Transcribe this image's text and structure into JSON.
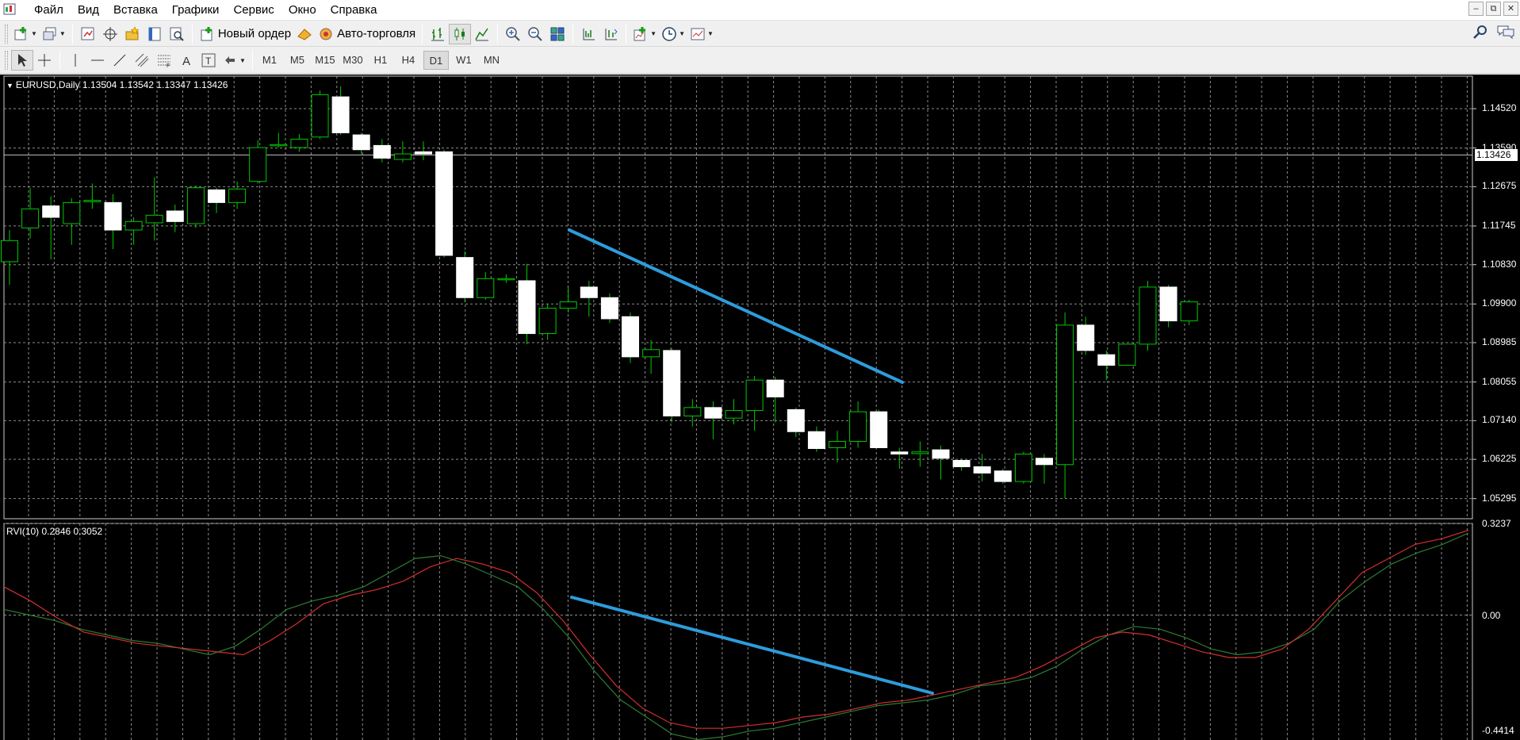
{
  "menu": {
    "items": [
      "Файл",
      "Вид",
      "Вставка",
      "Графики",
      "Сервис",
      "Окно",
      "Справка"
    ],
    "window_controls": [
      "–",
      "⧉",
      "✕"
    ]
  },
  "toolbar1": {
    "new_order_label": "Новый ордер",
    "auto_trading_label": "Авто-торговля"
  },
  "toolbar2": {
    "timeframes": [
      "M1",
      "M5",
      "M15",
      "M30",
      "H1",
      "H4",
      "D1",
      "W1",
      "MN"
    ],
    "active_timeframe": "D1"
  },
  "chart": {
    "main_title": "EURUSD,Daily  1.13504 1.13542 1.13347 1.13426",
    "indicator_title": "RVI(10) 0.2846 0.3052",
    "current_price": "1.13426",
    "price_labels": [
      "1.14520",
      "1.13590",
      "1.12675",
      "1.11745",
      "1.10830",
      "1.09900",
      "1.08985",
      "1.08055",
      "1.07140",
      "1.06225",
      "1.05295"
    ],
    "rvi_labels": [
      "0.3237",
      "0.00",
      "-0.4414"
    ],
    "colors": {
      "background": "#000000",
      "grid": "#8c8c8c",
      "bull_body": "#000000",
      "bear_body": "#ffffff",
      "wick": "#00c800",
      "rvi_main": "#2e7d32",
      "rvi_signal": "#d32f2f",
      "trendline": "#2d9cdb"
    }
  },
  "chart_data": {
    "type": "candlestick",
    "symbol": "EURUSD",
    "timeframe": "Daily",
    "ylim": [
      1.0482,
      1.1529
    ],
    "candles": [
      {
        "o": 1.109,
        "h": 1.1165,
        "l": 1.1035,
        "c": 1.114
      },
      {
        "o": 1.117,
        "h": 1.1265,
        "l": 1.1145,
        "c": 1.1215
      },
      {
        "o": 1.1222,
        "h": 1.1245,
        "l": 1.1095,
        "c": 1.1195
      },
      {
        "o": 1.118,
        "h": 1.124,
        "l": 1.113,
        "c": 1.123
      },
      {
        "o": 1.1232,
        "h": 1.1275,
        "l": 1.1215,
        "c": 1.1235
      },
      {
        "o": 1.123,
        "h": 1.125,
        "l": 1.112,
        "c": 1.1165
      },
      {
        "o": 1.1165,
        "h": 1.1195,
        "l": 1.113,
        "c": 1.1185
      },
      {
        "o": 1.1182,
        "h": 1.129,
        "l": 1.114,
        "c": 1.12
      },
      {
        "o": 1.121,
        "h": 1.1225,
        "l": 1.116,
        "c": 1.1185
      },
      {
        "o": 1.118,
        "h": 1.127,
        "l": 1.117,
        "c": 1.1265
      },
      {
        "o": 1.126,
        "h": 1.1265,
        "l": 1.1205,
        "c": 1.123
      },
      {
        "o": 1.123,
        "h": 1.128,
        "l": 1.1215,
        "c": 1.1262
      },
      {
        "o": 1.128,
        "h": 1.1378,
        "l": 1.1275,
        "c": 1.136
      },
      {
        "o": 1.1365,
        "h": 1.1395,
        "l": 1.136,
        "c": 1.1367
      },
      {
        "o": 1.136,
        "h": 1.1392,
        "l": 1.135,
        "c": 1.138
      },
      {
        "o": 1.1385,
        "h": 1.1495,
        "l": 1.138,
        "c": 1.1485
      },
      {
        "o": 1.148,
        "h": 1.1505,
        "l": 1.139,
        "c": 1.1395
      },
      {
        "o": 1.139,
        "h": 1.1395,
        "l": 1.1345,
        "c": 1.1355
      },
      {
        "o": 1.1365,
        "h": 1.138,
        "l": 1.1325,
        "c": 1.1335
      },
      {
        "o": 1.1332,
        "h": 1.1375,
        "l": 1.1325,
        "c": 1.1345
      },
      {
        "o": 1.135,
        "h": 1.1375,
        "l": 1.133,
        "c": 1.1345
      },
      {
        "o": 1.135,
        "h": 1.1355,
        "l": 1.11,
        "c": 1.1105
      },
      {
        "o": 1.11,
        "h": 1.1115,
        "l": 1.0995,
        "c": 1.1005
      },
      {
        "o": 1.1005,
        "h": 1.1065,
        "l": 1.1,
        "c": 1.105
      },
      {
        "o": 1.105,
        "h": 1.106,
        "l": 1.104,
        "c": 1.105
      },
      {
        "o": 1.1045,
        "h": 1.1085,
        "l": 1.0895,
        "c": 1.092
      },
      {
        "o": 1.092,
        "h": 1.099,
        "l": 1.0905,
        "c": 1.098
      },
      {
        "o": 1.098,
        "h": 1.103,
        "l": 1.097,
        "c": 1.0995
      },
      {
        "o": 1.103,
        "h": 1.1045,
        "l": 1.096,
        "c": 1.1005
      },
      {
        "o": 1.1005,
        "h": 1.1015,
        "l": 1.0945,
        "c": 1.0955
      },
      {
        "o": 1.096,
        "h": 1.097,
        "l": 1.085,
        "c": 1.0865
      },
      {
        "o": 1.0865,
        "h": 1.0905,
        "l": 1.0825,
        "c": 1.0882
      },
      {
        "o": 1.088,
        "h": 1.0885,
        "l": 1.071,
        "c": 1.0725
      },
      {
        "o": 1.0725,
        "h": 1.0765,
        "l": 1.07,
        "c": 1.0745
      },
      {
        "o": 1.0745,
        "h": 1.076,
        "l": 1.067,
        "c": 1.072
      },
      {
        "o": 1.072,
        "h": 1.0765,
        "l": 1.0705,
        "c": 1.0738
      },
      {
        "o": 1.0738,
        "h": 1.082,
        "l": 1.069,
        "c": 1.081
      },
      {
        "o": 1.081,
        "h": 1.0818,
        "l": 1.071,
        "c": 1.077
      },
      {
        "o": 1.074,
        "h": 1.0745,
        "l": 1.0675,
        "c": 1.0688
      },
      {
        "o": 1.0688,
        "h": 1.07,
        "l": 1.064,
        "c": 1.0648
      },
      {
        "o": 1.065,
        "h": 1.069,
        "l": 1.0615,
        "c": 1.0665
      },
      {
        "o": 1.0665,
        "h": 1.076,
        "l": 1.065,
        "c": 1.0735
      },
      {
        "o": 1.0735,
        "h": 1.074,
        "l": 1.065,
        "c": 1.065
      },
      {
        "o": 1.064,
        "h": 1.065,
        "l": 1.06,
        "c": 1.0635
      },
      {
        "o": 1.0636,
        "h": 1.0665,
        "l": 1.0605,
        "c": 1.064
      },
      {
        "o": 1.0645,
        "h": 1.0655,
        "l": 1.0575,
        "c": 1.0625
      },
      {
        "o": 1.062,
        "h": 1.0625,
        "l": 1.0595,
        "c": 1.0605
      },
      {
        "o": 1.0605,
        "h": 1.0635,
        "l": 1.057,
        "c": 1.059
      },
      {
        "o": 1.0595,
        "h": 1.06,
        "l": 1.0565,
        "c": 1.057
      },
      {
        "o": 1.057,
        "h": 1.064,
        "l": 1.0565,
        "c": 1.0635
      },
      {
        "o": 1.0625,
        "h": 1.0635,
        "l": 1.0565,
        "c": 1.061
      },
      {
        "o": 1.061,
        "h": 1.097,
        "l": 1.053,
        "c": 1.094
      },
      {
        "o": 1.094,
        "h": 1.096,
        "l": 1.087,
        "c": 1.088
      },
      {
        "o": 1.087,
        "h": 1.088,
        "l": 1.081,
        "c": 1.0845
      },
      {
        "o": 1.0845,
        "h": 1.0895,
        "l": 1.0845,
        "c": 1.0895
      },
      {
        "o": 1.0895,
        "h": 1.1045,
        "l": 1.088,
        "c": 1.103
      },
      {
        "o": 1.103,
        "h": 1.1035,
        "l": 1.0935,
        "c": 1.095
      },
      {
        "o": 1.095,
        "h": 1.1,
        "l": 1.094,
        "c": 1.0995
      }
    ],
    "rvi_ylim": [
      -0.4414,
      0.3237
    ],
    "rvi_main": [
      0.02,
      0.0,
      -0.02,
      -0.05,
      -0.07,
      -0.09,
      -0.1,
      -0.12,
      -0.14,
      -0.11,
      -0.05,
      0.02,
      0.05,
      0.07,
      0.1,
      0.15,
      0.2,
      0.21,
      0.18,
      0.14,
      0.1,
      0.02,
      -0.08,
      -0.2,
      -0.3,
      -0.36,
      -0.42,
      -0.44,
      -0.43,
      -0.41,
      -0.4,
      -0.38,
      -0.36,
      -0.34,
      -0.32,
      -0.31,
      -0.3,
      -0.28,
      -0.25,
      -0.24,
      -0.22,
      -0.18,
      -0.12,
      -0.07,
      -0.04,
      -0.05,
      -0.08,
      -0.12,
      -0.14,
      -0.13,
      -0.1,
      -0.05,
      0.05,
      0.12,
      0.18,
      0.22,
      0.25,
      0.29
    ],
    "rvi_signal": [
      0.1,
      0.05,
      -0.01,
      -0.06,
      -0.08,
      -0.1,
      -0.11,
      -0.12,
      -0.13,
      -0.14,
      -0.09,
      -0.03,
      0.04,
      0.07,
      0.09,
      0.12,
      0.17,
      0.2,
      0.18,
      0.15,
      0.08,
      -0.02,
      -0.14,
      -0.25,
      -0.33,
      -0.38,
      -0.4,
      -0.4,
      -0.39,
      -0.38,
      -0.36,
      -0.35,
      -0.33,
      -0.31,
      -0.3,
      -0.28,
      -0.26,
      -0.24,
      -0.22,
      -0.18,
      -0.13,
      -0.08,
      -0.06,
      -0.07,
      -0.1,
      -0.13,
      -0.15,
      -0.15,
      -0.12,
      -0.05,
      0.05,
      0.15,
      0.2,
      0.25,
      0.27,
      0.3
    ]
  }
}
